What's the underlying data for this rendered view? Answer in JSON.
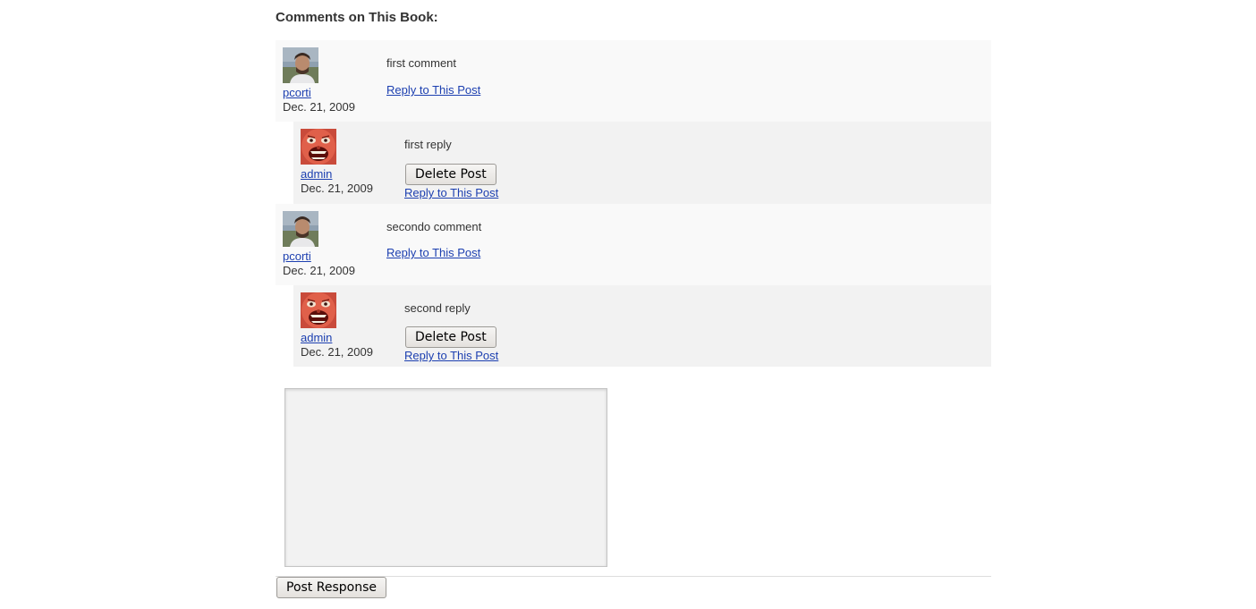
{
  "page": {
    "heading": "Comments on This Book:"
  },
  "comments": [
    {
      "author": "pcorti",
      "date": "Dec. 21, 2009",
      "text": "first comment",
      "reply_label": "Reply to This Post",
      "avatar": "user-photo-avatar",
      "replies": [
        {
          "author": "admin",
          "date": "Dec. 21, 2009",
          "text": "first reply",
          "delete_label": "Delete Post",
          "reply_label": "Reply to This Post",
          "avatar": "red-face-avatar"
        }
      ]
    },
    {
      "author": "pcorti",
      "date": "Dec. 21, 2009",
      "text": "secondo comment",
      "reply_label": "Reply to This Post",
      "avatar": "user-photo-avatar",
      "replies": [
        {
          "author": "admin",
          "date": "Dec. 21, 2009",
          "text": "second reply",
          "delete_label": "Delete Post",
          "reply_label": "Reply to This Post",
          "avatar": "red-face-avatar"
        }
      ]
    }
  ],
  "response_form": {
    "textarea_value": "",
    "submit_label": "Post Response"
  },
  "colors": {
    "link": "#1c3fb0",
    "comment_bg": "#f9f9f9",
    "reply_bg": "#f2f2f2",
    "text": "#333333"
  }
}
